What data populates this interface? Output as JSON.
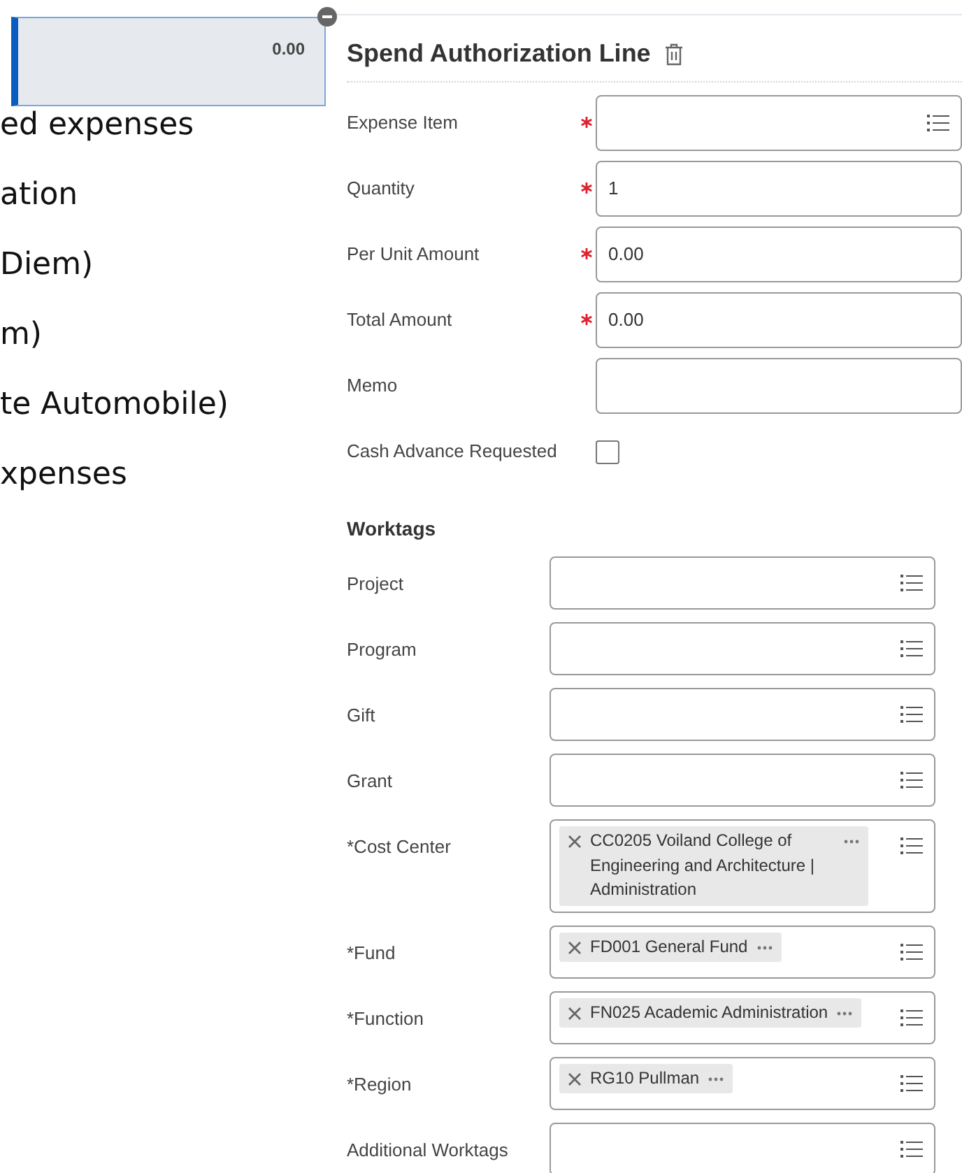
{
  "amount_card": {
    "value": "0.00"
  },
  "background_text": [
    "ed expenses",
    "ation",
    "Diem)",
    "m)",
    "te Automobile)",
    "xpenses"
  ],
  "panel": {
    "title": "Spend Authorization Line",
    "fields": [
      {
        "label": "Expense Item",
        "required": true,
        "prompt": true
      },
      {
        "label": "Quantity",
        "required": true,
        "prompt": false,
        "value": "1"
      },
      {
        "label": "Per Unit Amount",
        "required": true,
        "prompt": false,
        "value": "0.00"
      },
      {
        "label": "Total Amount",
        "required": true,
        "prompt": false,
        "value": "0.00"
      },
      {
        "label": "Memo",
        "required": false,
        "prompt": false
      }
    ],
    "checkbox": {
      "label": "Cash Advance Requested",
      "checked": false
    },
    "worktags": {
      "heading": "Worktags",
      "fields": [
        {
          "label": "Project"
        },
        {
          "label": "Program"
        },
        {
          "label": "Gift"
        },
        {
          "label": "Grant"
        },
        {
          "label": "*Cost Center",
          "tags": [
            "CC0205 Voiland College of Engineering and Architecture | Administration"
          ]
        },
        {
          "label": "*Fund",
          "tags": [
            "FD001 General Fund"
          ]
        },
        {
          "label": "*Function",
          "tags": [
            "FN025 Academic Administration"
          ]
        },
        {
          "label": "*Region",
          "tags": [
            "RG10 Pullman"
          ]
        },
        {
          "label": "Additional Worktags"
        }
      ]
    }
  }
}
